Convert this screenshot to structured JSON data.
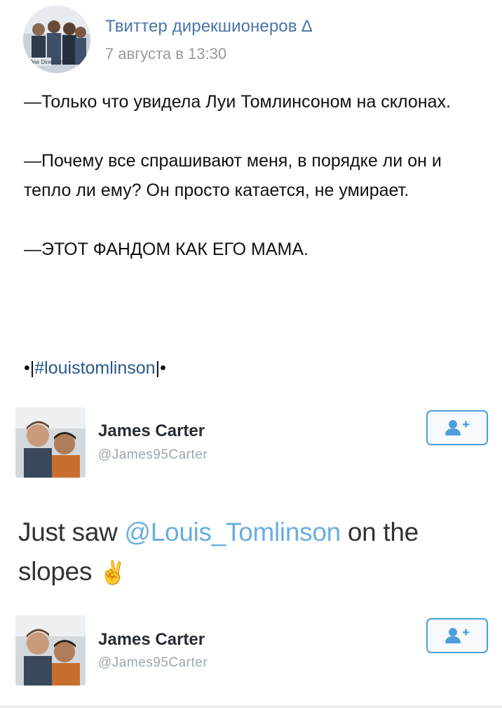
{
  "post": {
    "group_name": "Твиттер дирекшионеров ∆",
    "date": "7 августа в 13:30",
    "paragraphs": [
      "—Только что увидела Луи Томлинсоном на склонах.",
      "—Почему все спрашивают меня, в порядке ли он и тепло ли ему? Он просто катается, не умирает.",
      "—ЭТОТ ФАНДОМ КАК ЕГО МАМА."
    ],
    "hashtag_prefix": "•|",
    "hashtag": "#louistomlinson",
    "hashtag_suffix": "|•"
  },
  "tweet": {
    "author_name": "James Carter",
    "author_handle": "@James95Carter",
    "text_before": "Just saw ",
    "mention": "@Louis_Tomlinson",
    "text_after": " on the slopes",
    "emoji": "✌"
  },
  "tweet_repeat": {
    "author_name": "James Carter",
    "author_handle": "@James95Carter"
  },
  "icons": {
    "follow": "add-user-icon",
    "avatar_logo": "One Direction"
  },
  "colors": {
    "vk_link": "#4a76a8",
    "twitter_blue": "#4d9fdc",
    "mention": "#6aaedf"
  }
}
